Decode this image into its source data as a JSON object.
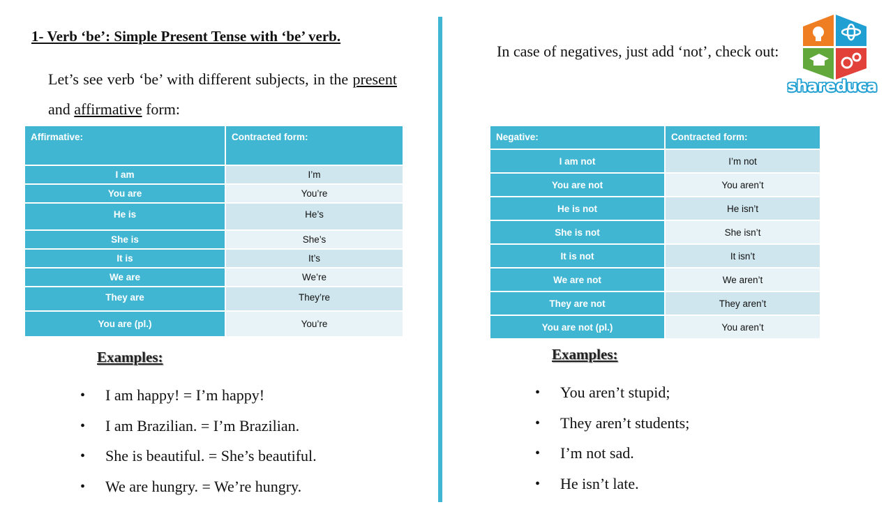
{
  "heading": "1- Verb ‘be’: Simple Present Tense with ‘be’ verb.",
  "intro": {
    "part1": "Let’s see verb ‘be’ with different subjects, in the ",
    "present": "present ",
    "and": "and ",
    "affirmative": "affirmative",
    "part2": " form:"
  },
  "negative_intro": "In case of negatives, just add ‘not’, check out:",
  "affirmative_table": {
    "headers": [
      "Affirmative:",
      "Contracted form:"
    ],
    "rows": [
      [
        "I am",
        "I’m"
      ],
      [
        "You are",
        "You’re"
      ],
      [
        "He is",
        "He’s"
      ],
      [
        "She is",
        "She’s"
      ],
      [
        "It is",
        "It’s"
      ],
      [
        "We are",
        "We’re"
      ],
      [
        "They are",
        "They’re"
      ],
      [
        "You are (pl.)",
        "You’re"
      ]
    ]
  },
  "negative_table": {
    "headers": [
      "Negative:",
      "Contracted form:"
    ],
    "rows": [
      [
        "I am not",
        "I’m not"
      ],
      [
        "You are not",
        "You aren’t"
      ],
      [
        "He is not",
        "He isn’t"
      ],
      [
        "She is not",
        "She isn’t"
      ],
      [
        "It is not",
        "It isn’t"
      ],
      [
        "We are not",
        "We aren’t"
      ],
      [
        "They are not",
        "They aren’t"
      ],
      [
        "You are not (pl.)",
        "You aren’t"
      ]
    ]
  },
  "examples_left": {
    "title": "Examples:",
    "items": [
      "I am happy! = I’m happy!",
      "I am Brazilian. = I’m Brazilian.",
      "She is beautiful. = She’s beautiful.",
      "We are hungry. = We’re hungry."
    ]
  },
  "examples_right": {
    "title": "Examples:",
    "items": [
      "You aren’t stupid;",
      "They aren’t students;",
      "I’m not sad.",
      "He isn’t late."
    ]
  },
  "logo": {
    "text": "shareduca",
    "icons": [
      "lightbulb-icon",
      "atom-icon",
      "graduation-cap-icon",
      "gears-icon"
    ],
    "colors": [
      "#ef7d22",
      "#1f9fd2",
      "#62a83b",
      "#e2413a"
    ]
  }
}
